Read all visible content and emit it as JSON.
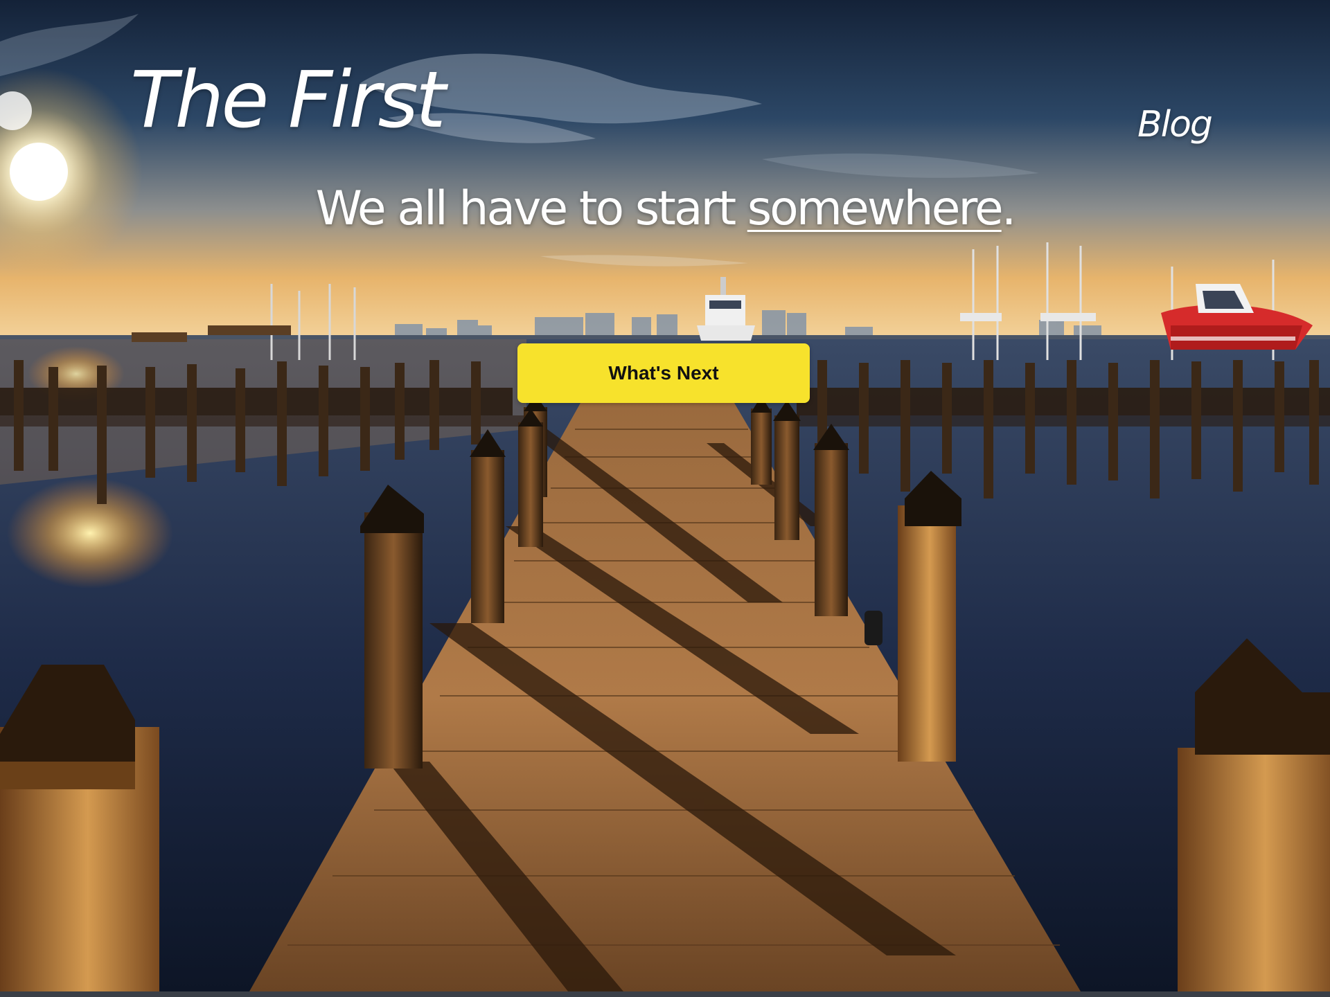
{
  "header": {
    "site_title": "The First",
    "nav": [
      {
        "label": "Blog"
      }
    ]
  },
  "hero": {
    "tagline_prefix": "We all have to start ",
    "tagline_link": "somewhere",
    "tagline_suffix": ".",
    "cta_label": "What's Next",
    "background_description_icon": "pier-sunset-image"
  },
  "colors": {
    "cta_background": "#f7e22c",
    "text": "#ffffff"
  }
}
